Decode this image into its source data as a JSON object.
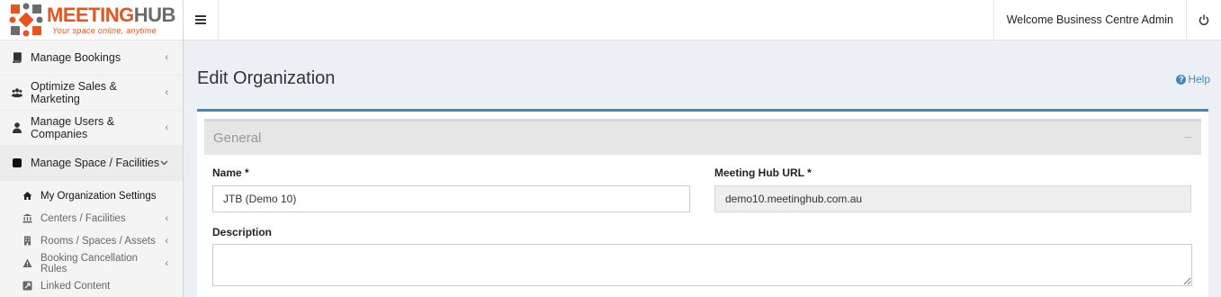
{
  "brand": {
    "name_part1": "MEETING",
    "name_part2": "HUB",
    "tagline": "Your space online, anytime",
    "colors": {
      "orange": "#e8541e",
      "grey": "#6b6b6b"
    }
  },
  "topbar": {
    "menu_icon": "hamburger-icon",
    "welcome": "Welcome Business Centre Admin",
    "power_icon": "power-icon"
  },
  "sidebar": {
    "items": [
      {
        "label": "Manage Bookings",
        "icon": "book-icon"
      },
      {
        "label": "Optimize Sales & Marketing",
        "icon": "users-icon"
      },
      {
        "label": "Manage Users & Companies",
        "icon": "user-icon"
      },
      {
        "label": "Manage Space / Facilities",
        "icon": "square-icon"
      }
    ],
    "subitems": [
      {
        "label": "My Organization Settings",
        "icon": "home-icon"
      },
      {
        "label": "Centers / Facilities",
        "icon": "bank-icon"
      },
      {
        "label": "Rooms / Spaces / Assets",
        "icon": "building-icon"
      },
      {
        "label": "Booking Cancellation Rules",
        "icon": "warning-icon"
      },
      {
        "label": "Linked Content",
        "icon": "link-icon"
      }
    ]
  },
  "page": {
    "title": "Edit Organization",
    "help": "Help",
    "accent": "#3c8dbc"
  },
  "section": {
    "title": "General",
    "collapse": "−"
  },
  "form": {
    "name_label": "Name *",
    "name_value": "JTB (Demo 10)",
    "url_label": "Meeting Hub URL *",
    "url_value": "demo10.meetinghub.com.au",
    "description_label": "Description",
    "description_value": ""
  }
}
